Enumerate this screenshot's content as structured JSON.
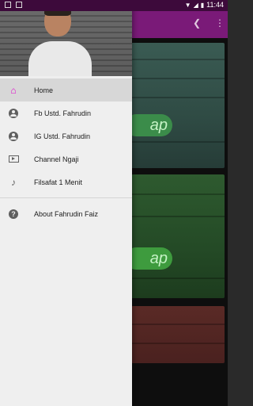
{
  "status_bar": {
    "time": "11:44",
    "left_icons": [
      "gallery-icon",
      "a-icon"
    ],
    "right_icons": [
      "wifi-icon",
      "signal-icon",
      "battery-icon"
    ]
  },
  "background_app": {
    "toolbar_color": "#7a1a78",
    "actions": [
      "share-icon",
      "more-vert-icon"
    ],
    "card_badge_text": "ap"
  },
  "drawer": {
    "header_image": "profile-photo",
    "menu": [
      {
        "label": "Home",
        "icon": "home-icon",
        "active": true
      },
      {
        "label": "Fb Ustd. Fahrudin",
        "icon": "account-circle-icon"
      },
      {
        "label": "IG Ustd. Fahrudin",
        "icon": "account-circle-icon"
      },
      {
        "label": "Channel Ngaji",
        "icon": "video-play-icon"
      },
      {
        "label": "Filsafat 1 Menit",
        "icon": "music-note-icon"
      }
    ],
    "secondary_menu": [
      {
        "label": "About Fahrudin Faiz",
        "icon": "help-icon"
      }
    ],
    "accent_color": "#e10ecd"
  }
}
